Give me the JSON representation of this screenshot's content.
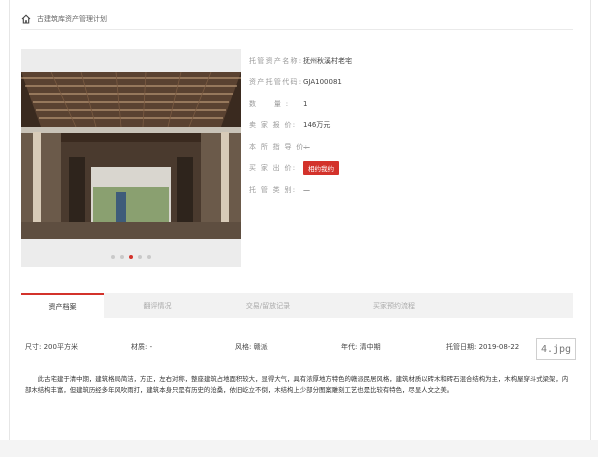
{
  "breadcrumb": {
    "text": "古建筑库资产管理计划"
  },
  "asset": {
    "rows": [
      {
        "label": "托管资产名称:",
        "value": "抚州秋溪村老宅"
      },
      {
        "label": "资产托管代码:",
        "value": "GJA100081"
      },
      {
        "label": "数　　量 :",
        "value": "1"
      },
      {
        "label": "卖 家 报 价:",
        "value": "146万元"
      },
      {
        "label": "本 所 指 导 价:",
        "value": "—"
      },
      {
        "label": "买 家 出 价:",
        "value": ""
      },
      {
        "label": "托 管 类 别:",
        "value": "—"
      }
    ],
    "bid_button": "相约我约"
  },
  "carousel": {
    "dots": 5,
    "active": 2
  },
  "tabs": [
    {
      "label": "资产档案",
      "active": true
    },
    {
      "label": "翻评情况",
      "active": false
    },
    {
      "label": "交易/留放记录",
      "active": false
    },
    {
      "label": "买家预约流程",
      "active": false
    }
  ],
  "attributes": [
    {
      "label": "尺寸:",
      "value": "200平方米"
    },
    {
      "label": "材质:",
      "value": "-"
    },
    {
      "label": "风格:",
      "value": "赣派"
    },
    {
      "label": "年代:",
      "value": "清中期"
    },
    {
      "label": "托管日期:",
      "value": "2019-08-22"
    }
  ],
  "stamp": "4.jpg",
  "description": "此古宅建于清中期，建筑格局简洁，方正，左右对称，整座建筑占地面积较大，显得大气，具有浓厚地方特色的赣派民居风格，建筑材质以砖木和砖石混合结构为主，木构屋穿斗式梁架，内部木结构丰富，但建筑历经多年风吹雨打，建筑本身只是有历史的沧桑，依旧屹立不倒，木结构上少部分图案雕刻工艺也是比较有特色，尽显人文之美。",
  "colors": {
    "accent": "#d3322b"
  }
}
